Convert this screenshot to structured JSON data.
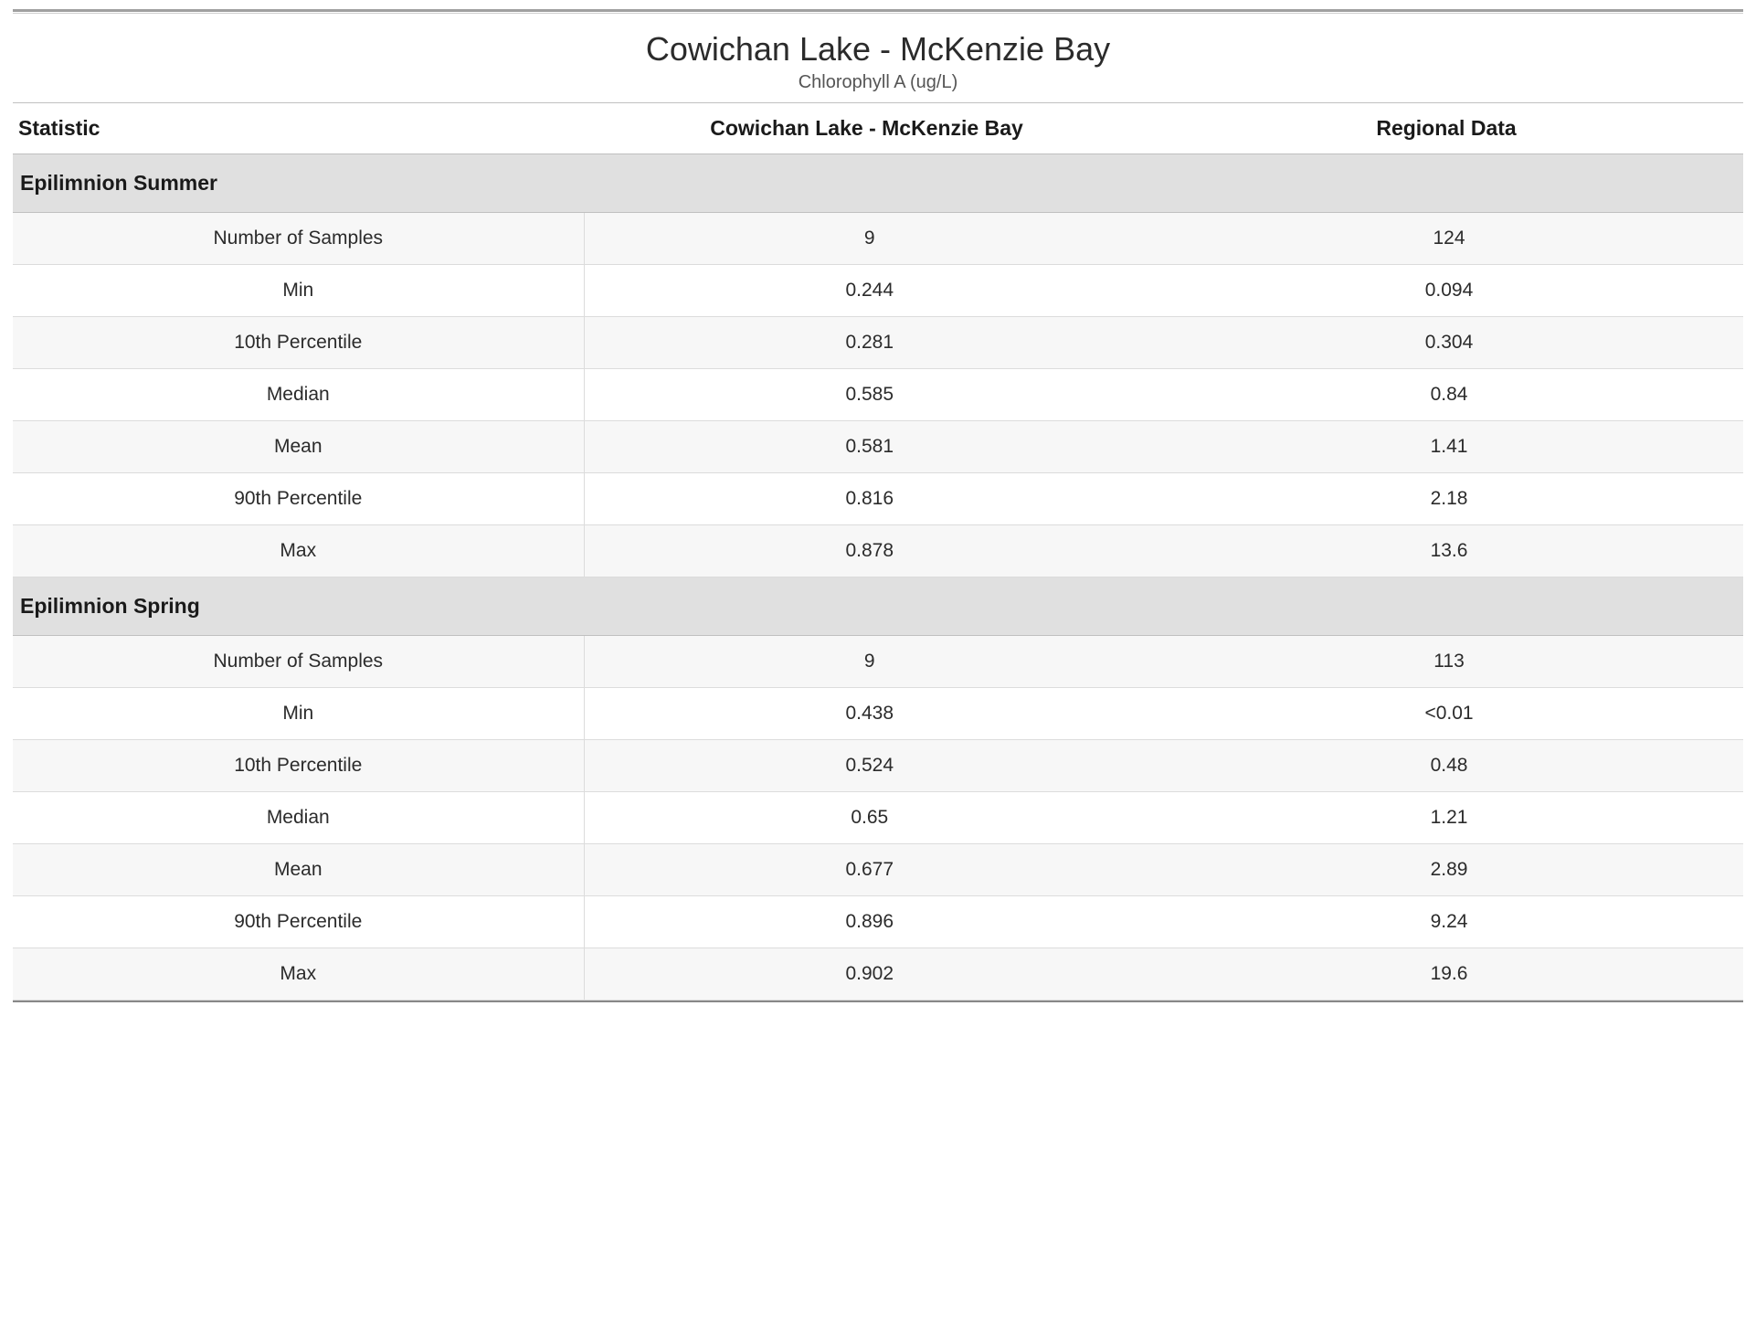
{
  "title": "Cowichan Lake - McKenzie Bay",
  "subtitle": "Chlorophyll A (ug/L)",
  "columns": {
    "stat": "Statistic",
    "site": "Cowichan Lake - McKenzie Bay",
    "region": "Regional Data"
  },
  "sections": [
    {
      "name": "Epilimnion Summer",
      "rows": [
        {
          "stat": "Number of Samples",
          "site": "9",
          "region": "124"
        },
        {
          "stat": "Min",
          "site": "0.244",
          "region": "0.094"
        },
        {
          "stat": "10th Percentile",
          "site": "0.281",
          "region": "0.304"
        },
        {
          "stat": "Median",
          "site": "0.585",
          "region": "0.84"
        },
        {
          "stat": "Mean",
          "site": "0.581",
          "region": "1.41"
        },
        {
          "stat": "90th Percentile",
          "site": "0.816",
          "region": "2.18"
        },
        {
          "stat": "Max",
          "site": "0.878",
          "region": "13.6"
        }
      ]
    },
    {
      "name": "Epilimnion Spring",
      "rows": [
        {
          "stat": "Number of Samples",
          "site": "9",
          "region": "113"
        },
        {
          "stat": "Min",
          "site": "0.438",
          "region": "<0.01"
        },
        {
          "stat": "10th Percentile",
          "site": "0.524",
          "region": "0.48"
        },
        {
          "stat": "Median",
          "site": "0.65",
          "region": "1.21"
        },
        {
          "stat": "Mean",
          "site": "0.677",
          "region": "2.89"
        },
        {
          "stat": "90th Percentile",
          "site": "0.896",
          "region": "9.24"
        },
        {
          "stat": "Max",
          "site": "0.902",
          "region": "19.6"
        }
      ]
    }
  ]
}
